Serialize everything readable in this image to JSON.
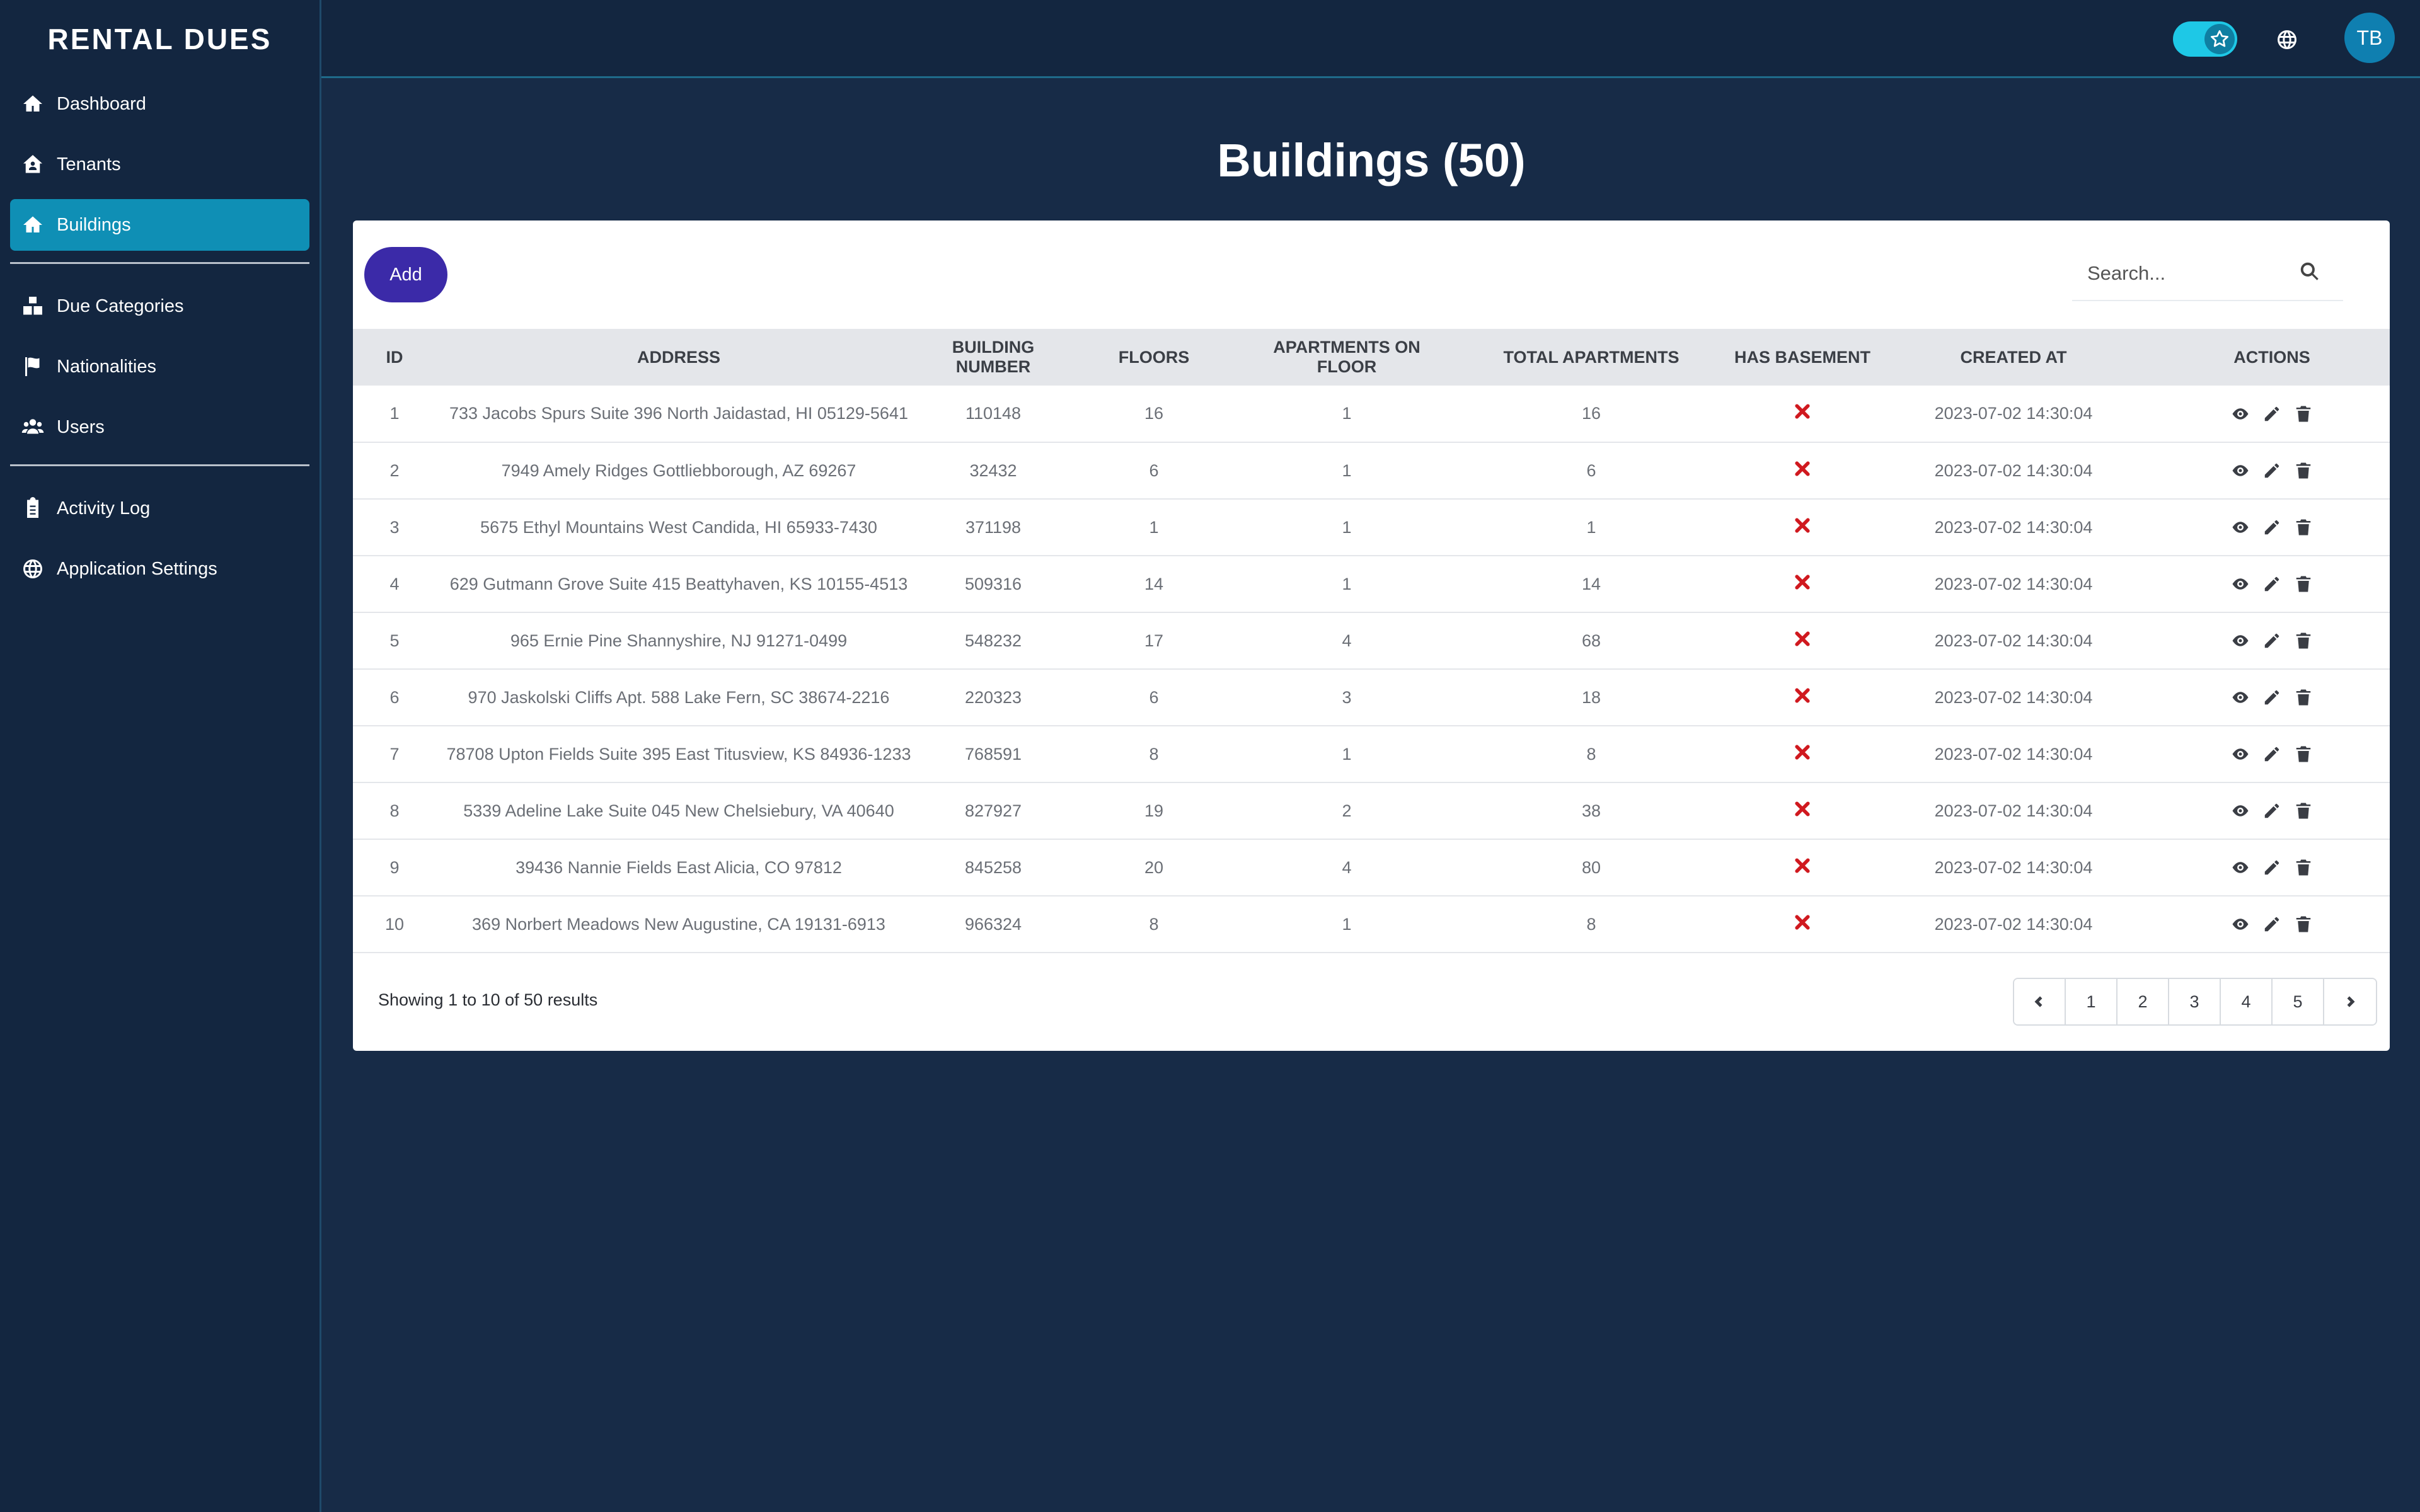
{
  "app": {
    "brand": "RENTAL DUES"
  },
  "sidebar": {
    "items": [
      {
        "label": "Dashboard",
        "icon": "home-icon"
      },
      {
        "label": "Tenants",
        "icon": "house-user-icon"
      },
      {
        "label": "Buildings",
        "icon": "home-icon",
        "active": true
      },
      {
        "label": "Due Categories",
        "icon": "boxes-icon"
      },
      {
        "label": "Nationalities",
        "icon": "flag-icon"
      },
      {
        "label": "Users",
        "icon": "users-icon"
      },
      {
        "label": "Activity Log",
        "icon": "clipboard-icon"
      },
      {
        "label": "Application Settings",
        "icon": "globe-icon"
      }
    ]
  },
  "topbar": {
    "avatar_initials": "TB"
  },
  "page": {
    "title": "Buildings (50)"
  },
  "toolbar": {
    "add_label": "Add",
    "search_placeholder": "Search..."
  },
  "table": {
    "columns": [
      "ID",
      "ADDRESS",
      "BUILDING NUMBER",
      "FLOORS",
      "APARTMENTS ON FLOOR",
      "TOTAL APARTMENTS",
      "HAS BASEMENT",
      "CREATED AT",
      "ACTIONS"
    ],
    "rows": [
      {
        "id": "1",
        "address": "733 Jacobs Spurs Suite 396 North Jaidastad, HI 05129-5641",
        "building_number": "110148",
        "floors": "16",
        "apartments_on_floor": "1",
        "total_apartments": "16",
        "created_at": "2023-07-02 14:30:04"
      },
      {
        "id": "2",
        "address": "7949 Amely Ridges Gottliebborough, AZ 69267",
        "building_number": "32432",
        "floors": "6",
        "apartments_on_floor": "1",
        "total_apartments": "6",
        "created_at": "2023-07-02 14:30:04"
      },
      {
        "id": "3",
        "address": "5675 Ethyl Mountains West Candida, HI 65933-7430",
        "building_number": "371198",
        "floors": "1",
        "apartments_on_floor": "1",
        "total_apartments": "1",
        "created_at": "2023-07-02 14:30:04"
      },
      {
        "id": "4",
        "address": "629 Gutmann Grove Suite 415 Beattyhaven, KS 10155-4513",
        "building_number": "509316",
        "floors": "14",
        "apartments_on_floor": "1",
        "total_apartments": "14",
        "created_at": "2023-07-02 14:30:04"
      },
      {
        "id": "5",
        "address": "965 Ernie Pine Shannyshire, NJ 91271-0499",
        "building_number": "548232",
        "floors": "17",
        "apartments_on_floor": "4",
        "total_apartments": "68",
        "created_at": "2023-07-02 14:30:04"
      },
      {
        "id": "6",
        "address": "970 Jaskolski Cliffs Apt. 588 Lake Fern, SC 38674-2216",
        "building_number": "220323",
        "floors": "6",
        "apartments_on_floor": "3",
        "total_apartments": "18",
        "created_at": "2023-07-02 14:30:04"
      },
      {
        "id": "7",
        "address": "78708 Upton Fields Suite 395 East Titusview, KS 84936-1233",
        "building_number": "768591",
        "floors": "8",
        "apartments_on_floor": "1",
        "total_apartments": "8",
        "created_at": "2023-07-02 14:30:04"
      },
      {
        "id": "8",
        "address": "5339 Adeline Lake Suite 045 New Chelsiebury, VA 40640",
        "building_number": "827927",
        "floors": "19",
        "apartments_on_floor": "2",
        "total_apartments": "38",
        "created_at": "2023-07-02 14:30:04"
      },
      {
        "id": "9",
        "address": "39436 Nannie Fields East Alicia, CO 97812",
        "building_number": "845258",
        "floors": "20",
        "apartments_on_floor": "4",
        "total_apartments": "80",
        "created_at": "2023-07-02 14:30:04"
      },
      {
        "id": "10",
        "address": "369 Norbert Meadows New Augustine, CA 19131-6913",
        "building_number": "966324",
        "floors": "8",
        "apartments_on_floor": "1",
        "total_apartments": "8",
        "created_at": "2023-07-02 14:30:04"
      }
    ]
  },
  "footer": {
    "showing": "Showing 1 to 10 of 50 results",
    "pages": [
      "1",
      "2",
      "3",
      "4",
      "5"
    ]
  },
  "colors": {
    "background": "#172b47",
    "sidebar": "#132640",
    "active_nav": "#0f8fb5",
    "add_button": "#3b2aa8",
    "basement_no": "#d0191f",
    "toggle": "#1ec8e6",
    "avatar": "#0f7fb0"
  }
}
